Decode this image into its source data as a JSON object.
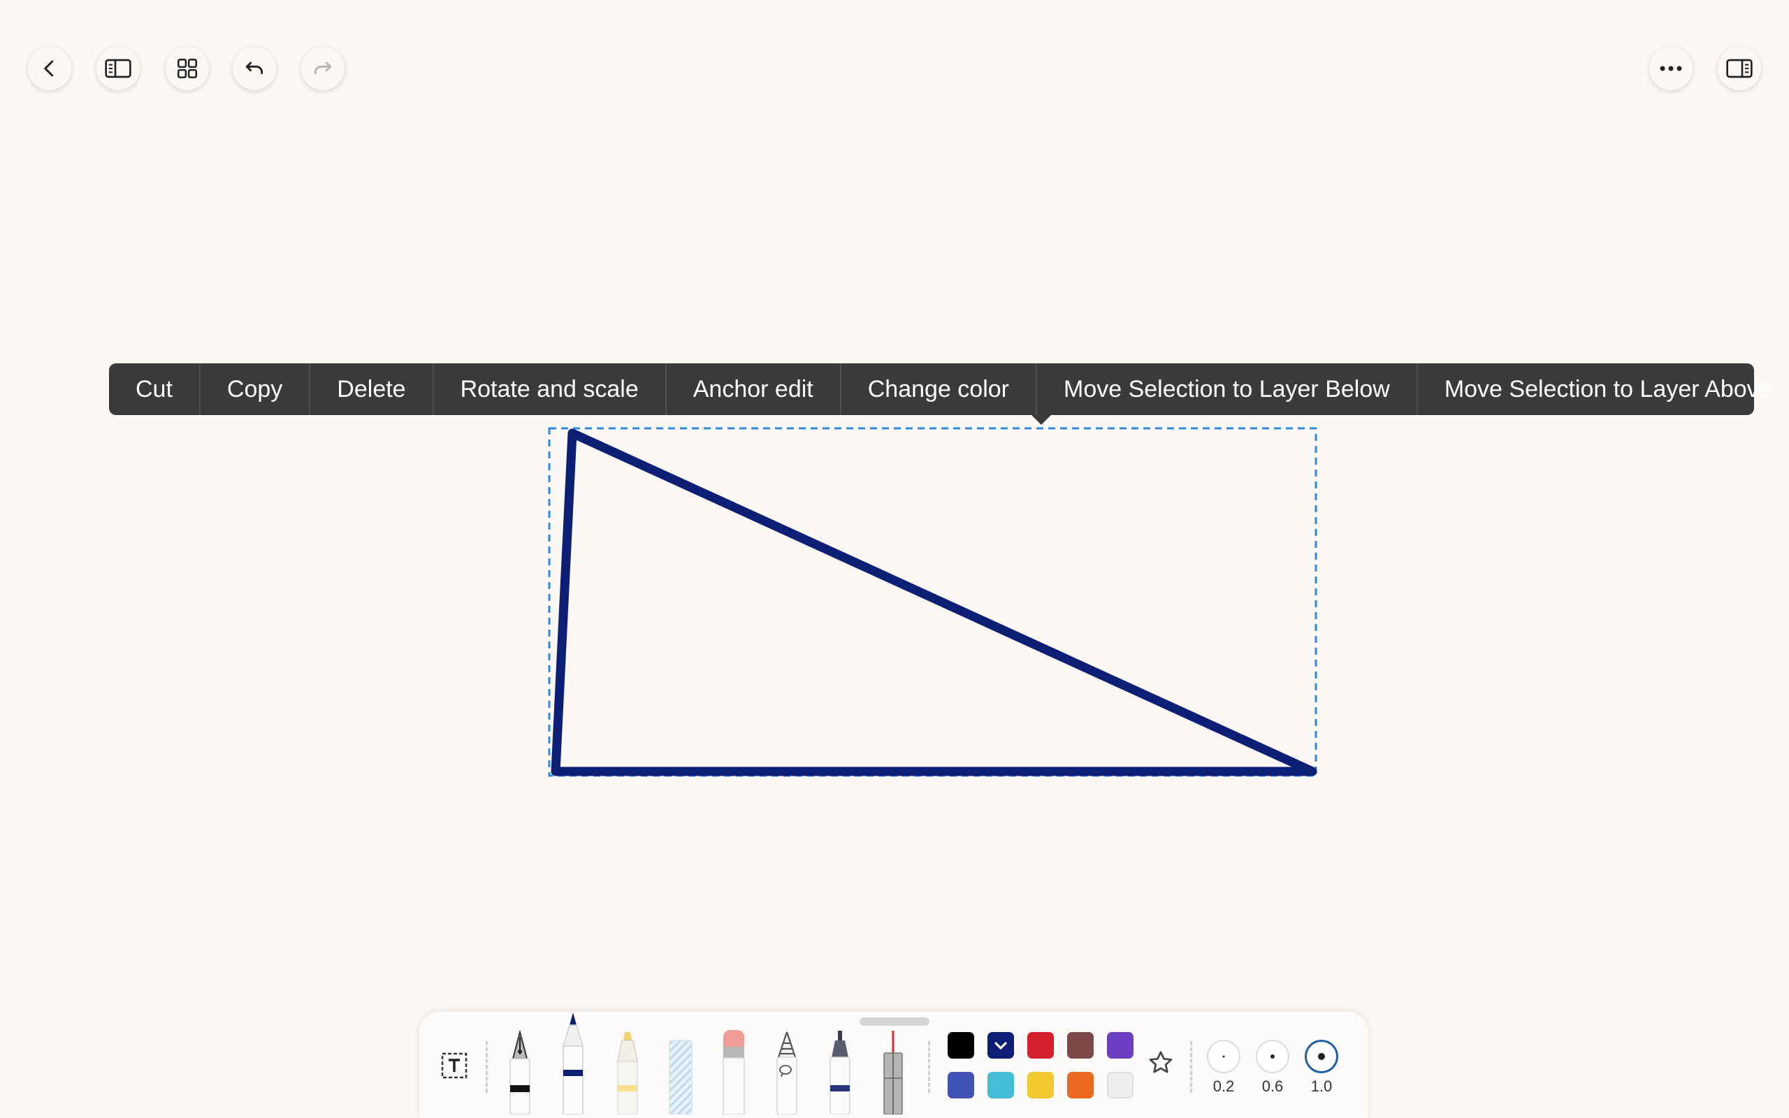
{
  "context_menu": {
    "items": [
      "Cut",
      "Copy",
      "Delete",
      "Rotate and scale",
      "Anchor edit",
      "Change color",
      "Move Selection to Layer Below",
      "Move Selection to Layer Above"
    ]
  },
  "top_bar": {
    "left_icons": [
      "back-icon",
      "sidebar-toggle-icon",
      "grid-view-icon",
      "undo-icon",
      "redo-icon"
    ],
    "right_icons": [
      "more-options-icon",
      "split-view-icon"
    ]
  },
  "canvas": {
    "shape": "triangle",
    "stroke_color": "#0d1f74",
    "selection_color": "#2a8ae0"
  },
  "toolbar": {
    "tools": [
      "text-tool",
      "fountain-pen",
      "ballpoint-pen",
      "highlighter",
      "crayon",
      "eraser",
      "lasso",
      "marker",
      "laser-pointer"
    ],
    "palette": [
      "#000000",
      "#0d1f74",
      "#d61f2c",
      "#7e4a48",
      "#6b3fc0",
      "#3d53b6",
      "#45bcd6",
      "#f5c830",
      "#ec6a1f",
      "#f0eeec"
    ],
    "selected_color": "#0d1f74",
    "sizes": [
      {
        "label": "0.2"
      },
      {
        "label": "0.6"
      },
      {
        "label": "1.0"
      }
    ],
    "selected_size": "1.0"
  }
}
